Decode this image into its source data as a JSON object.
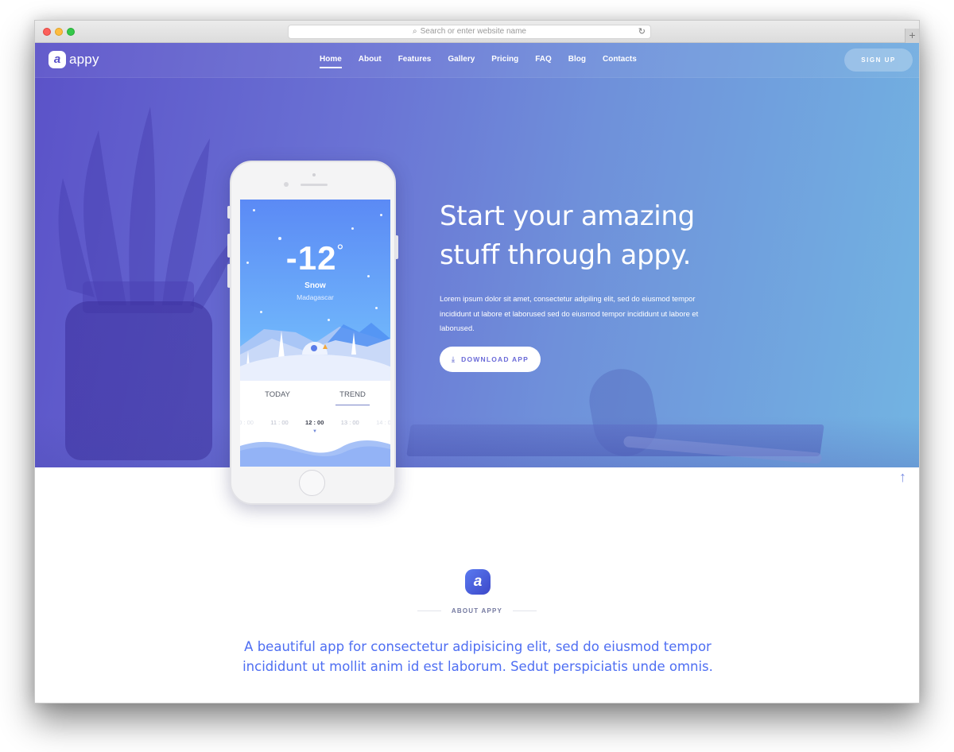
{
  "browser": {
    "url_placeholder": "Search or enter website name",
    "search_icon": "magnifier-icon",
    "reload_icon": "reload-icon",
    "new_tab_label": "+"
  },
  "site": {
    "brand": {
      "badge": "a",
      "name": "appy"
    },
    "nav": [
      {
        "label": "Home",
        "active": true
      },
      {
        "label": "About",
        "active": false
      },
      {
        "label": "Features",
        "active": false
      },
      {
        "label": "Gallery",
        "active": false
      },
      {
        "label": "Pricing",
        "active": false
      },
      {
        "label": "FAQ",
        "active": false
      },
      {
        "label": "Blog",
        "active": false
      },
      {
        "label": "Contacts",
        "active": false
      }
    ],
    "signup_label": "SIGN UP"
  },
  "hero": {
    "title_line1": "Start your amazing",
    "title_line2": "stuff through appy.",
    "text": "Lorem ipsum dolor sit amet, consectetur adipiling elit, sed do eiusmod tempor incididunt ut labore et laborused sed do eiusmod tempor incididunt ut labore et laborused.",
    "download_label": "DOWNLOAD APP",
    "download_icon": "download-icon"
  },
  "phone_app": {
    "temperature": "-12",
    "degree": "°",
    "condition": "Snow",
    "location": "Madagascar",
    "tabs": [
      {
        "label": "TODAY",
        "active": false
      },
      {
        "label": "TREND",
        "active": true
      }
    ],
    "times": [
      "10 : 00",
      "11 : 00",
      "12 : 00",
      "13 : 00",
      "14 : 00"
    ],
    "current_time": "12 : 00"
  },
  "scroll_top_icon": "arrow-up-icon",
  "about": {
    "badge": "a",
    "label": "ABOUT APPY",
    "text": "A beautiful app for consectetur adipisicing elit, sed do eiusmod tempor incididunt ut mollit anim id est laborum. Sedut perspiciatis unde omnis."
  },
  "colors": {
    "accent": "#4e6ef2",
    "hero_gradient_start": "#5b52c8",
    "hero_gradient_end": "#72b4e2"
  }
}
